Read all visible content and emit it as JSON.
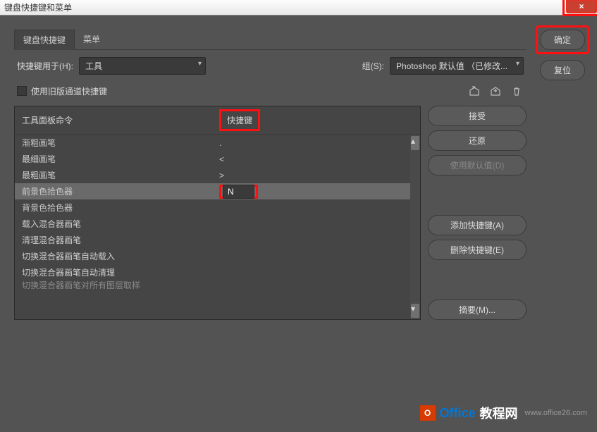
{
  "window": {
    "title": "键盘快捷键和菜单",
    "close": "×"
  },
  "tabs": {
    "shortcuts": "键盘快捷键",
    "menus": "菜单"
  },
  "shortcutsFor": {
    "label": "快捷键用于(H):",
    "value": "工具"
  },
  "set": {
    "label": "组(S):",
    "value": "Photoshop 默认值 （已修改..."
  },
  "legacyCheckbox": "使用旧版通道快捷键",
  "columns": {
    "command": "工具面板命令",
    "shortcut": "快捷键"
  },
  "rows": [
    {
      "cmd": "渐粗画笔",
      "key": "."
    },
    {
      "cmd": "最细画笔",
      "key": "<"
    },
    {
      "cmd": "最粗画笔",
      "key": ">"
    },
    {
      "cmd": "前景色拾色器",
      "key": "N"
    },
    {
      "cmd": "背景色拾色器",
      "key": ""
    },
    {
      "cmd": "载入混合器画笔",
      "key": ""
    },
    {
      "cmd": "清理混合器画笔",
      "key": ""
    },
    {
      "cmd": "切换混合器画笔自动载入",
      "key": ""
    },
    {
      "cmd": "切换混合器画笔自动清理",
      "key": ""
    },
    {
      "cmd": "切换混合器画笔对所有图层取样",
      "key": ""
    }
  ],
  "selectedRowIndex": 3,
  "sideButtons": {
    "accept": "接受",
    "undo": "还原",
    "useDefault": "使用默认值(D)",
    "addShortcut": "添加快捷键(A)",
    "deleteShortcut": "删除快捷键(E)",
    "summary": "摘要(M)..."
  },
  "rightButtons": {
    "ok": "确定",
    "reset": "复位"
  },
  "watermark": {
    "logo": "O",
    "text1": "Office",
    "text2": "教程网",
    "url": "www.office26.com"
  }
}
